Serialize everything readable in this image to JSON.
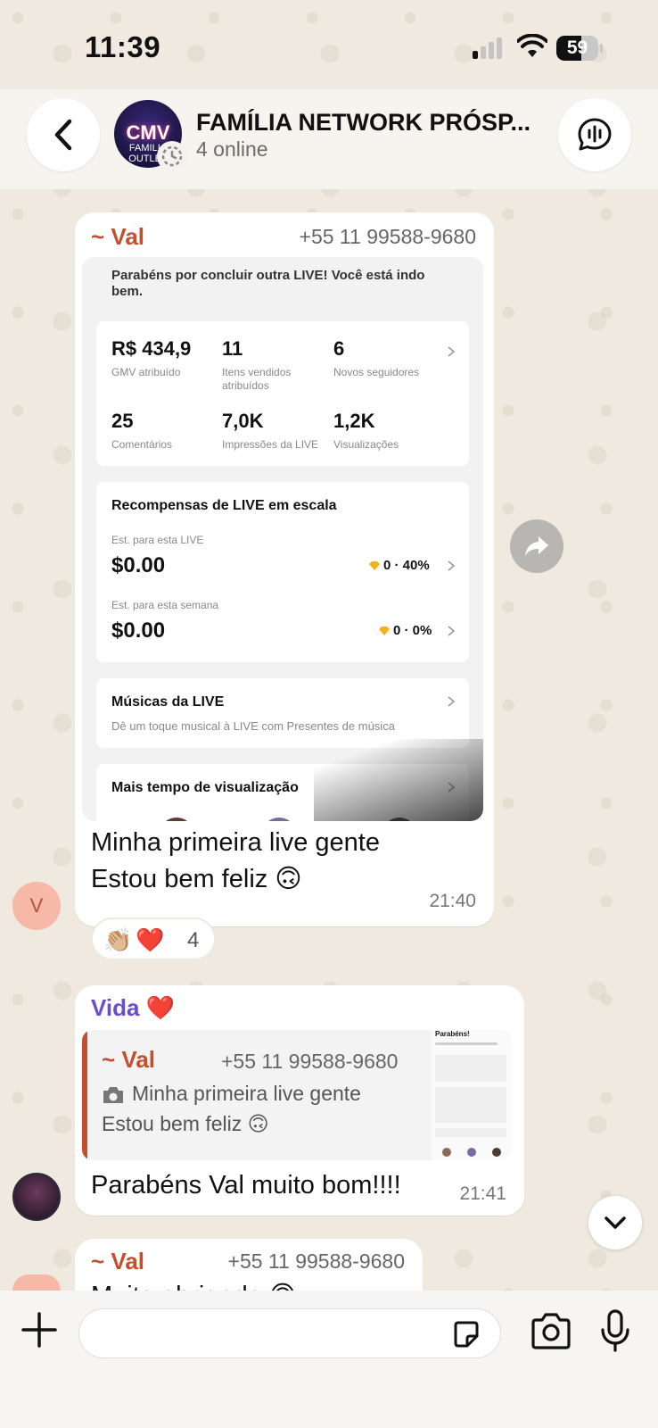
{
  "status_bar": {
    "time": "11:39",
    "battery": "59",
    "battery_level": 0.59
  },
  "header": {
    "avatar_text": "CMV",
    "avatar_sub": "FAMILIA OUTLET",
    "title": "FAMÍLIA NETWORK PRÓSP...",
    "subtitle": "4 online"
  },
  "messages": [
    {
      "sender": "~ Val",
      "sender_color": "#c2502f",
      "phone": "+55 11 99588-9680",
      "attachment": {
        "heading": "Parabéns por concluir outra LIVE! Você está indo bem.",
        "stats": [
          {
            "value": "R$ 434,9",
            "label": "GMV atribuído"
          },
          {
            "value": "11",
            "label": "Itens vendidos atribuídos"
          },
          {
            "value": "6",
            "label": "Novos seguidores"
          },
          {
            "value": "25",
            "label": "Comentários"
          },
          {
            "value": "7,0K",
            "label": "Impressões da LIVE"
          },
          {
            "value": "1,2K",
            "label": "Visualizações"
          }
        ],
        "rewards": {
          "title": "Recompensas de LIVE em escala",
          "rows": [
            {
              "label": "Est. para esta LIVE",
              "amount": "$0.00",
              "meta": "0 · 40%"
            },
            {
              "label": "Est. para esta semana",
              "amount": "$0.00",
              "meta": "0 · 0%"
            }
          ]
        },
        "music": {
          "title": "Músicas da LIVE",
          "desc": "Dê um toque musical à LIVE com Presentes de música"
        },
        "more": {
          "title": "Mais tempo de visualização"
        }
      },
      "text_line1": "Minha primeira live gente",
      "text_line2": "Estou bem feliz 🙃",
      "time": "21:40",
      "reactions": {
        "emojis": "👏🏼❤️",
        "count": "4"
      },
      "avatar_letter": "V"
    },
    {
      "sender": "Vida ❤️",
      "sender_color": "#6a4bd6",
      "quote": {
        "sender": "~ Val",
        "phone": "+55 11 99588-9680",
        "line1": "Minha primeira live gente",
        "line2": "Estou bem feliz 🙃",
        "thumb_title": "Parabéns!"
      },
      "text": "Parabéns Val muito bom!!!!",
      "time": "21:41"
    },
    {
      "sender": "~ Val",
      "phone": "+55 11 99588-9680",
      "text_partial": "Muito obrigada 🙃"
    }
  ]
}
